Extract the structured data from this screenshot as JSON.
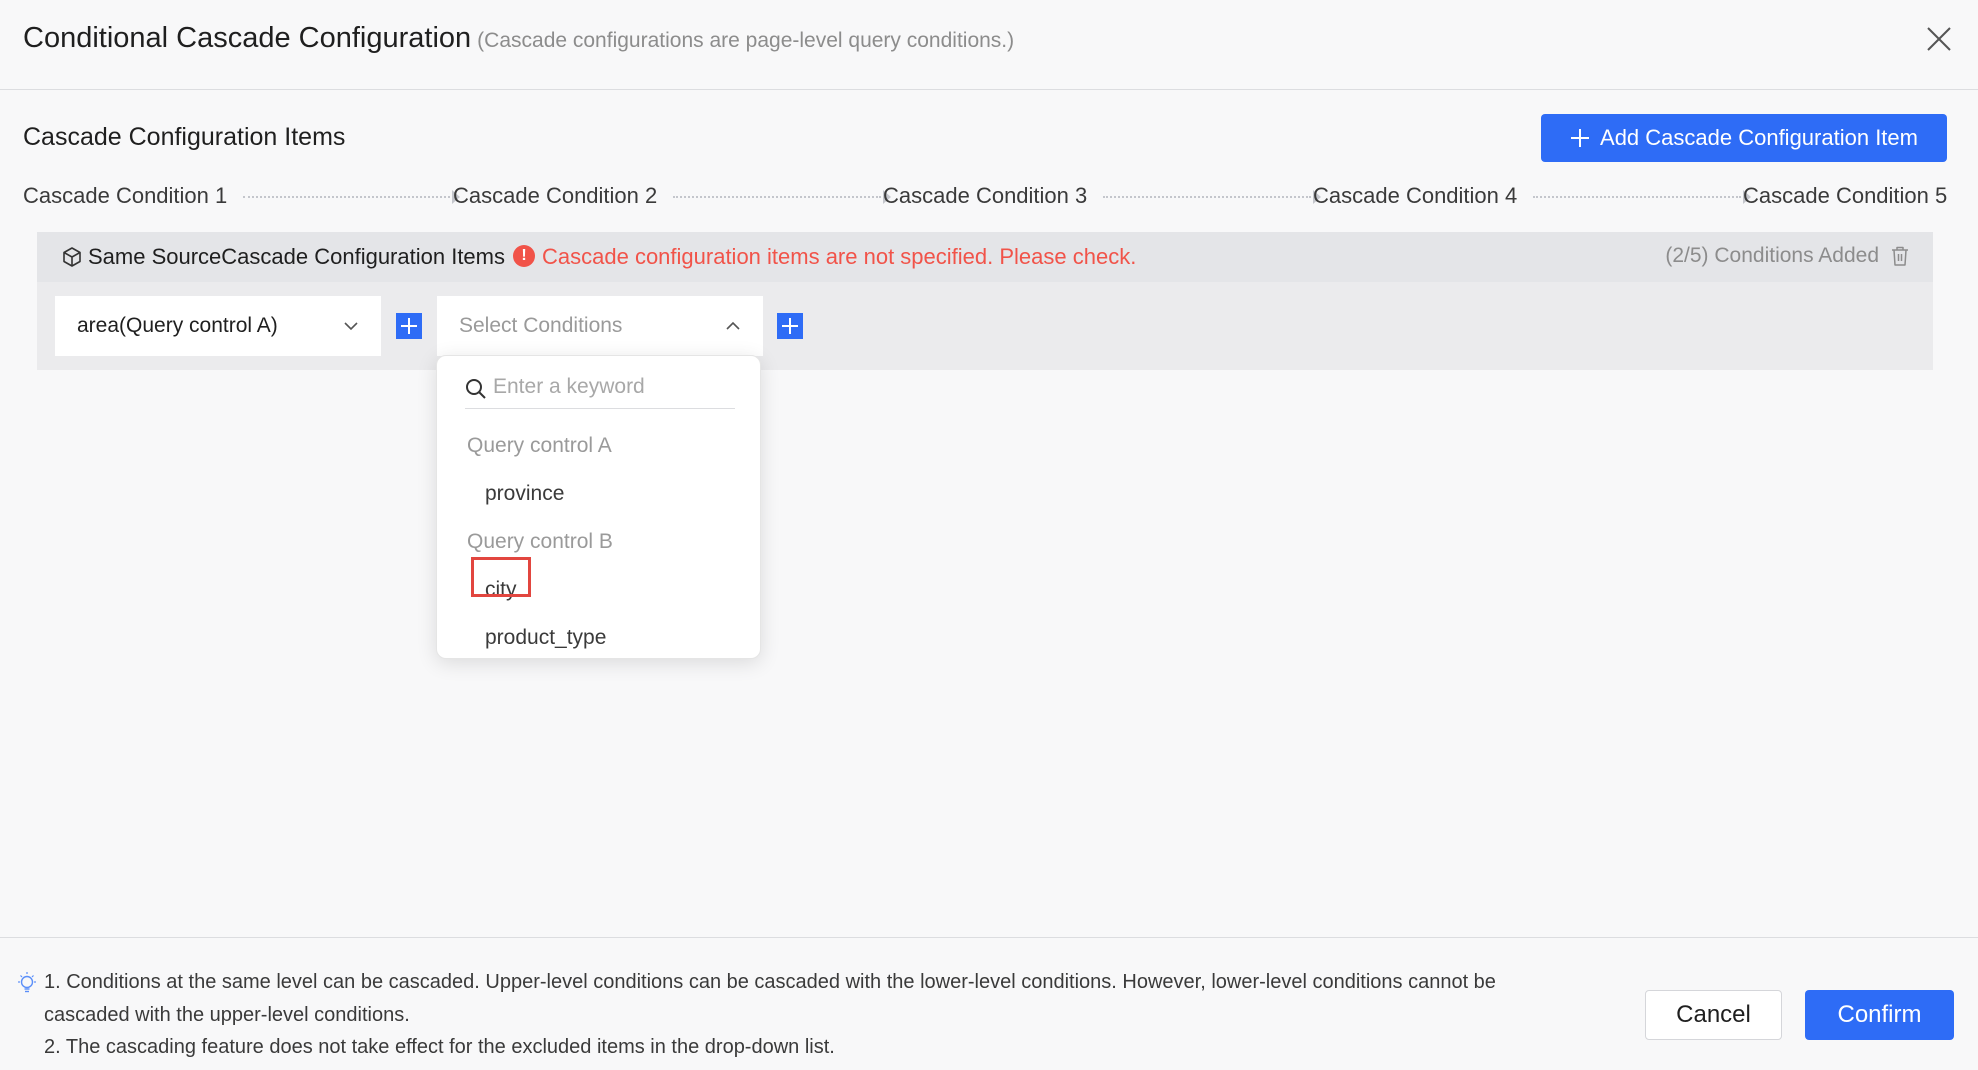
{
  "dialog": {
    "title": "Conditional Cascade Configuration",
    "subtitle": "(Cascade configurations are page-level query conditions.)",
    "close_icon": "close-icon"
  },
  "section": {
    "title": "Cascade Configuration Items",
    "add_button_label": "Add Cascade Configuration Item"
  },
  "steps": [
    "Cascade Condition 1",
    "Cascade Condition 2",
    "Cascade Condition 3",
    "Cascade Condition 4",
    "Cascade Condition 5"
  ],
  "config_item": {
    "title": "Same SourceCascade Configuration Items",
    "error_message": "Cascade configuration items are not specified. Please check.",
    "count_text": "(2/5) Conditions Added",
    "first_select_value": "area(Query control A)",
    "second_select_placeholder": "Select Conditions",
    "error_color": "#f15349"
  },
  "dropdown": {
    "search_placeholder": "Enter a keyword",
    "groups": [
      {
        "label": "Query control A",
        "items": [
          "province"
        ]
      },
      {
        "label": "Query control B",
        "items": [
          "city",
          "product_type"
        ]
      }
    ],
    "highlighted_item": "city"
  },
  "footer": {
    "notes": [
      "1. Conditions at the same level can be cascaded. Upper-level conditions can be cascaded with the lower-level conditions. However, lower-level conditions cannot be",
      "cascaded with the upper-level conditions.",
      "2. The cascading feature does not take effect for the excluded items in the drop-down list."
    ],
    "cancel_label": "Cancel",
    "confirm_label": "Confirm"
  },
  "colors": {
    "primary": "#2e6cf6",
    "error": "#f15349",
    "highlight_border": "#e2463f"
  }
}
